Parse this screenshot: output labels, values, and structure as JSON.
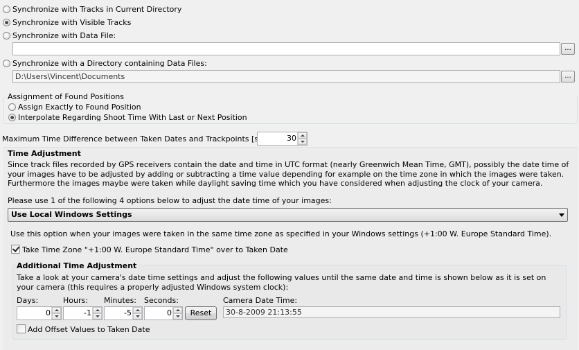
{
  "sync_options": {
    "opt_current_dir": "Synchronize with Tracks in Current Directory",
    "opt_visible_tracks": "Synchronize with Visible Tracks",
    "opt_data_file": "Synchronize with Data File:",
    "data_file_path": "",
    "opt_directory": "Synchronize with a Directory containing Data Files:",
    "directory_path": "D:\\Users\\Vincent\\Documents",
    "browse_label": "...",
    "selected": "opt_visible_tracks"
  },
  "assignment": {
    "title": "Assignment of Found Positions",
    "opt_exact": "Assign Exactly to Found Position",
    "opt_interpolate": "Interpolate Regarding Shoot Time With Last or Next Position",
    "selected": "opt_interpolate"
  },
  "max_time": {
    "label": "Maximum Time Difference between Taken Dates and Trackpoints [seconds]:",
    "value": "30"
  },
  "time_adjustment": {
    "title": "Time Adjustment",
    "description": "Since track files recorded by GPS receivers contain the date and time in UTC format (nearly Greenwich Mean Time, GMT), possibly the date time of your images have to be adjusted by adding or subtracting a time value depending for example on the time zone in which the images were taken. Furthermore the images maybe were taken while daylight saving time which you have considered when adjusting the clock of your camera.",
    "instruction": "Please use 1 of the following 4 options below to adjust the date time of your images:",
    "method_selected": "Use Local Windows Settings",
    "method_description": "Use this option when your images were taken in the same time zone as specified in your Windows settings (+1:00 W. Europe Standard Time).",
    "take_timezone_label": "Take Time Zone \"+1:00 W. Europe Standard Time\" over to Taken Date",
    "take_timezone_checked": true
  },
  "additional": {
    "title": "Additional Time Adjustment",
    "description": "Take a look at your camera's date time settings and adjust the following values until the same date and time is shown below as it is  set on your camera (this requires a properly adjusted Windows system clock):",
    "days_label": "Days:",
    "days_value": "0",
    "hours_label": "Hours:",
    "hours_value": "-1",
    "minutes_label": "Minutes:",
    "minutes_value": "-5",
    "seconds_label": "Seconds:",
    "seconds_value": "0",
    "reset_label": "Reset",
    "camera_dt_label": "Camera Date Time:",
    "camera_dt_value": "30-8-2009 21:13:55",
    "add_offset_label": "Add Offset Values to Taken Date",
    "add_offset_checked": false
  }
}
